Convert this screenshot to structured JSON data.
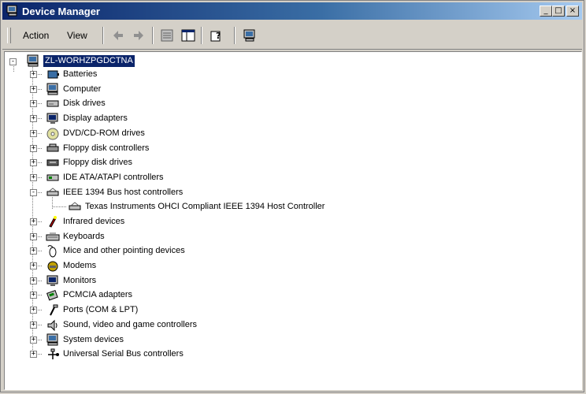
{
  "window": {
    "title": "Device Manager",
    "buttons": {
      "minimize": "_",
      "maximize": "□",
      "close": "×"
    }
  },
  "toolbar": {
    "menus": [
      "Action",
      "View"
    ],
    "icons": [
      "back-arrow-icon",
      "forward-arrow-icon",
      "properties-icon",
      "details-view-icon",
      "help-icon",
      "computer-scan-icon"
    ]
  },
  "tree": {
    "root": {
      "label": "ZL-WORHZPGDCTNA",
      "selected": true,
      "icon": "computer-icon"
    },
    "items": [
      {
        "label": "Batteries",
        "icon": "battery-icon",
        "expanded": false
      },
      {
        "label": "Computer",
        "icon": "computer-icon",
        "expanded": false
      },
      {
        "label": "Disk drives",
        "icon": "disk-drive-icon",
        "expanded": false
      },
      {
        "label": "Display adapters",
        "icon": "display-icon",
        "expanded": false
      },
      {
        "label": "DVD/CD-ROM drives",
        "icon": "cd-drive-icon",
        "expanded": false
      },
      {
        "label": "Floppy disk controllers",
        "icon": "floppy-controller-icon",
        "expanded": false
      },
      {
        "label": "Floppy disk drives",
        "icon": "floppy-drive-icon",
        "expanded": false
      },
      {
        "label": "IDE ATA/ATAPI controllers",
        "icon": "ide-controller-icon",
        "expanded": false
      },
      {
        "label": "IEEE 1394 Bus host controllers",
        "icon": "ieee1394-icon",
        "expanded": true,
        "children": [
          {
            "label": "Texas Instruments OHCI Compliant IEEE 1394 Host Controller",
            "icon": "ieee1394-icon"
          }
        ]
      },
      {
        "label": "Infrared devices",
        "icon": "infrared-icon",
        "expanded": false
      },
      {
        "label": "Keyboards",
        "icon": "keyboard-icon",
        "expanded": false
      },
      {
        "label": "Mice and other pointing devices",
        "icon": "mouse-icon",
        "expanded": false
      },
      {
        "label": "Modems",
        "icon": "modem-icon",
        "expanded": false
      },
      {
        "label": "Monitors",
        "icon": "monitor-icon",
        "expanded": false
      },
      {
        "label": "PCMCIA adapters",
        "icon": "pcmcia-icon",
        "expanded": false
      },
      {
        "label": "Ports (COM & LPT)",
        "icon": "port-icon",
        "expanded": false
      },
      {
        "label": "Sound, video and game controllers",
        "icon": "sound-icon",
        "expanded": false
      },
      {
        "label": "System devices",
        "icon": "system-icon",
        "expanded": false
      },
      {
        "label": "Universal Serial Bus controllers",
        "icon": "usb-icon",
        "expanded": false
      }
    ]
  },
  "colors": {
    "titlebar_start": "#0a246a",
    "titlebar_end": "#a6caf0",
    "selection": "#0a246a",
    "chrome": "#d4d0c8"
  }
}
